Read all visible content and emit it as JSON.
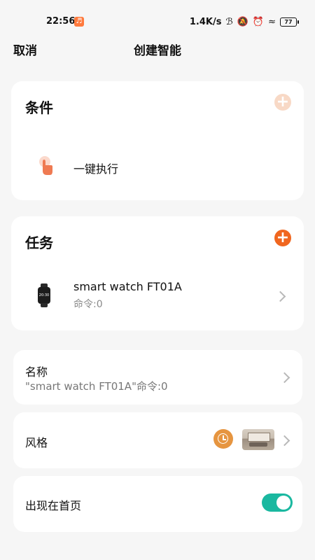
{
  "status_bar": {
    "time": "22:56",
    "net_speed": "1.4K/s",
    "battery": "77"
  },
  "header": {
    "cancel": "取消",
    "title": "创建智能"
  },
  "conditions": {
    "title": "条件",
    "item_label": "一键执行",
    "add_button_color": "#f8d9c6"
  },
  "tasks": {
    "title": "任务",
    "add_button_color": "#f0661f",
    "device_name": "smart watch   FT01A",
    "device_sub": "命令:0"
  },
  "name_row": {
    "label": "名称",
    "value": "\"smart watch   FT01A\"命令:0"
  },
  "style_row": {
    "label": "风格",
    "clock_color": "#e69540"
  },
  "homepage_row": {
    "label": "出现在首页",
    "toggle_on": true,
    "toggle_color": "#1ab8a0"
  }
}
